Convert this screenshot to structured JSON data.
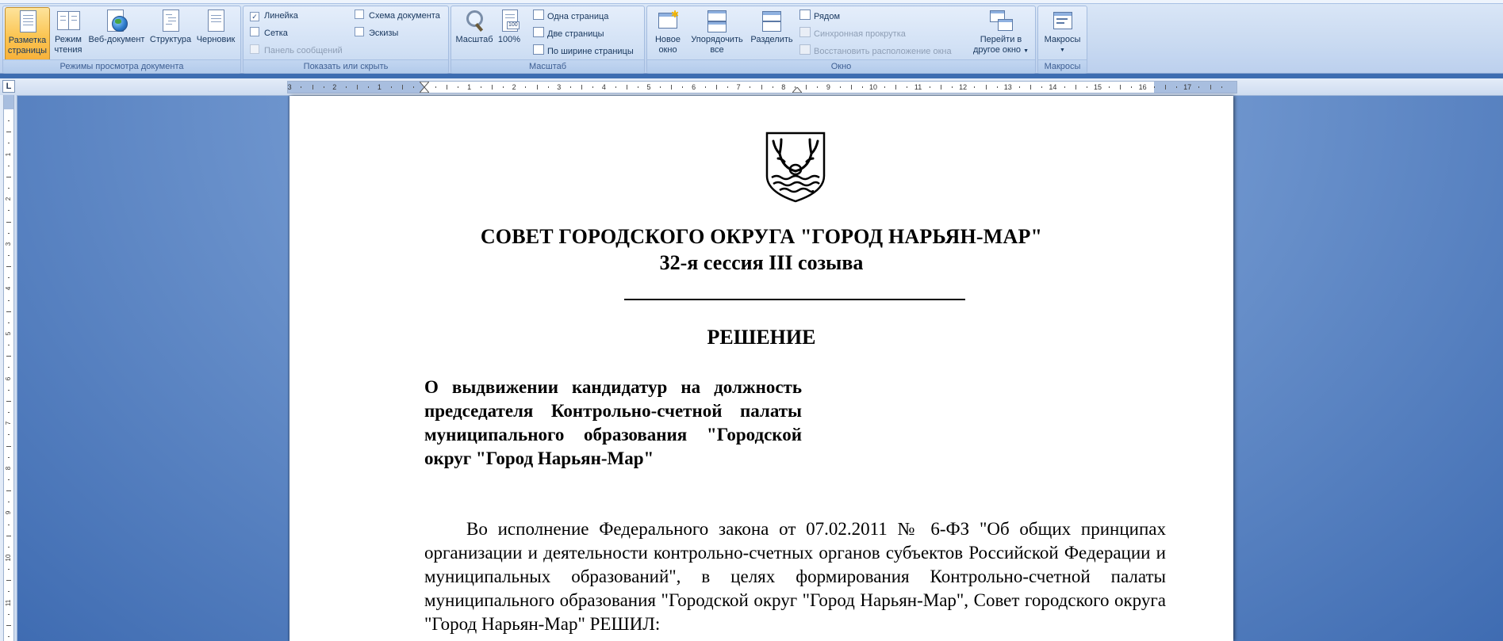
{
  "ribbon": {
    "groups": {
      "views": {
        "label": "Режимы просмотра документа",
        "buttons": [
          {
            "label1": "Разметка",
            "label2": "страницы",
            "active": true
          },
          {
            "label1": "Режим",
            "label2": "чтения"
          },
          {
            "label1": "Веб-документ",
            "label2": ""
          },
          {
            "label1": "Структура",
            "label2": ""
          },
          {
            "label1": "Черновик",
            "label2": ""
          }
        ]
      },
      "show_hide": {
        "label": "Показать или скрыть",
        "ruler": "Линейка",
        "grid": "Сетка",
        "message_bar": "Панель сообщений",
        "doc_map": "Схема документа",
        "thumbnails": "Эскизы"
      },
      "zoom": {
        "label": "Масштаб",
        "zoom_btn": "Масштаб",
        "hundred_btn": "100%",
        "hundred_icon_text": "100",
        "one_page": "Одна страница",
        "two_pages": "Две страницы",
        "page_width": "По ширине страницы"
      },
      "window": {
        "label": "Окно",
        "new_window1": "Новое",
        "new_window2": "окно",
        "arrange1": "Упорядочить",
        "arrange2": "все",
        "split": "Разделить",
        "side_by_side": "Рядом",
        "sync_scroll": "Синхронная прокрутка",
        "reset_position": "Восстановить расположение окна",
        "switch1": "Перейти в",
        "switch2": "другое окно"
      },
      "macros": {
        "label": "Макросы",
        "button": "Макросы"
      }
    }
  },
  "ruler": {
    "corner_symbol": "L",
    "h_labels": [
      "3",
      "2",
      "1",
      "1",
      "2",
      "3",
      "4",
      "5",
      "6",
      "7",
      "8",
      "9",
      "10",
      "11",
      "12",
      "13",
      "14",
      "15",
      "16",
      "17"
    ],
    "v_labels": [
      "1",
      "2",
      "3",
      "4",
      "5",
      "6",
      "7",
      "8",
      "9",
      "10",
      "11"
    ]
  },
  "document": {
    "title_line1": "СОВЕТ ГОРОДСКОГО ОКРУГА \"ГОРОД НАРЬЯН-МАР\"",
    "title_line2": "32-я сессия III созыва",
    "decision": "РЕШЕНИЕ",
    "subject": "О выдвижении кандидатур на должность председателя Контрольно-счетной палаты муниципального образования \"Городской округ \"Город Нарьян-Мар\"",
    "body": "Во исполнение Федерального закона от 07.02.2011 № 6-ФЗ \"Об общих принципах организации и деятельности контрольно-счетных органов субъектов Российской Федерации и муниципальных образований\", в целях формирования Контрольно-счетной палаты муниципального образования \"Городской округ \"Город Нарьян-Мар\", Совет городского округа \"Город Нарьян-Мар\" РЕШИЛ:"
  },
  "colors": {
    "ribbon_bg": "#c9daf1",
    "active_button": "#fbc552",
    "workspace": "#3f6cb2",
    "page": "#ffffff"
  }
}
